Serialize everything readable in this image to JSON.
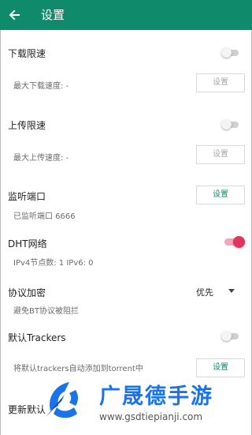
{
  "appbar": {
    "title": "设置",
    "back_icon": "arrow-left-icon"
  },
  "download_limit": {
    "label": "下载限速",
    "enabled": false,
    "max_speed_label": "最大下载速度: -",
    "button": "设置"
  },
  "upload_limit": {
    "label": "上传限速",
    "enabled": false,
    "max_speed_label": "最大上传速度: -",
    "button": "设置"
  },
  "listen_port": {
    "label": "监听端口",
    "button": "设置",
    "status": "已监听端口 6666"
  },
  "dht": {
    "label": "DHT网络",
    "enabled": true,
    "nodes": "IPv4节点数: 1 IPv6: 0"
  },
  "encryption": {
    "label": "协议加密",
    "value": "优先",
    "description": "避免BT协议被阻拦"
  },
  "trackers": {
    "label": "默认Trackers",
    "enabled": false,
    "description": "将默认trackers自动添加到torrent中",
    "button": "设置"
  },
  "update_trackers": {
    "label": "更新默认"
  },
  "watermark": {
    "title": "广晟德手游",
    "url": "www.gsdtiepianji.com"
  },
  "colors": {
    "appbar": "#0f8a6a",
    "accent": "#e2345f",
    "button_text": "#0f8a6a"
  }
}
